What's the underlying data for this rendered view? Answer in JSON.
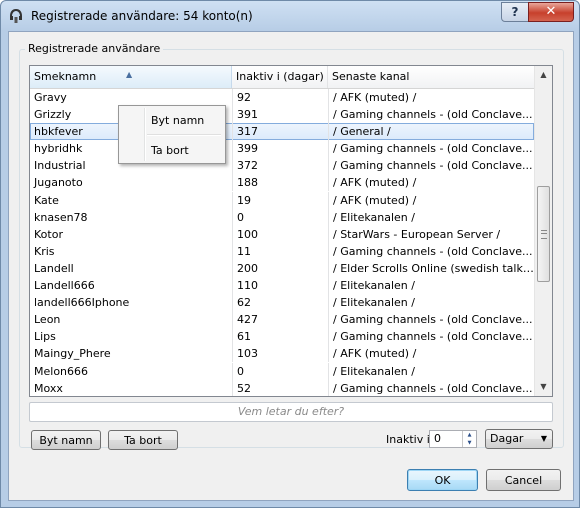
{
  "window": {
    "title": "Registrerade användare: 54 konto(n)",
    "help_glyph": "?",
    "close_glyph": "✕"
  },
  "group": {
    "title": "Registrerade användare"
  },
  "columns": [
    "Smeknamn",
    "Inaktiv i (dagar)",
    "Senaste kanal"
  ],
  "rows": [
    [
      "Gravy",
      "92",
      "/ AFK (muted) /"
    ],
    [
      "Grizzly",
      "391",
      "/ Gaming channels - (old Conclave..."
    ],
    [
      "hbkfever",
      "317",
      "/ General /"
    ],
    [
      "hybridhk",
      "399",
      "/ Gaming channels - (old Conclave..."
    ],
    [
      "Industrial",
      "372",
      "/ Gaming channels - (old Conclave..."
    ],
    [
      "Juganoto",
      "188",
      "/ AFK (muted) /"
    ],
    [
      "Kate",
      "19",
      "/ AFK (muted) /"
    ],
    [
      "knasen78",
      "0",
      "/ Elitekanalen /"
    ],
    [
      "Kotor",
      "100",
      "/ StarWars - European Server /"
    ],
    [
      "Kris",
      "11",
      "/ Gaming channels - (old Conclave..."
    ],
    [
      "Landell",
      "200",
      "/ Elder Scrolls Online (swedish talki..."
    ],
    [
      "Landell666",
      "110",
      "/ Elitekanalen /"
    ],
    [
      "landell666Iphone",
      "62",
      "/ Elitekanalen /"
    ],
    [
      "Leon",
      "427",
      "/ Gaming channels - (old Conclave..."
    ],
    [
      "Lips",
      "61",
      "/ Gaming channels - (old Conclave..."
    ],
    [
      "Maingy_Phere",
      "103",
      "/ AFK (muted) /"
    ],
    [
      "Melon666",
      "0",
      "/ Elitekanalen /"
    ],
    [
      "Moxx",
      "52",
      "/ Gaming channels - (old Conclave..."
    ]
  ],
  "selected_row": "hbkfever",
  "context_menu": {
    "rename": "Byt namn",
    "delete": "Ta bort"
  },
  "search": {
    "placeholder": "Vem letar du efter?"
  },
  "buttons": {
    "rename": "Byt namn",
    "delete": "Ta bort",
    "ok": "OK",
    "cancel": "Cancel"
  },
  "filter": {
    "label": "Inaktiv i",
    "value": "0",
    "unit": "Dagar"
  },
  "colors": {
    "selection": "#dbeafb",
    "selection_border": "#84acdd",
    "title_bar": "#b7cde6"
  }
}
